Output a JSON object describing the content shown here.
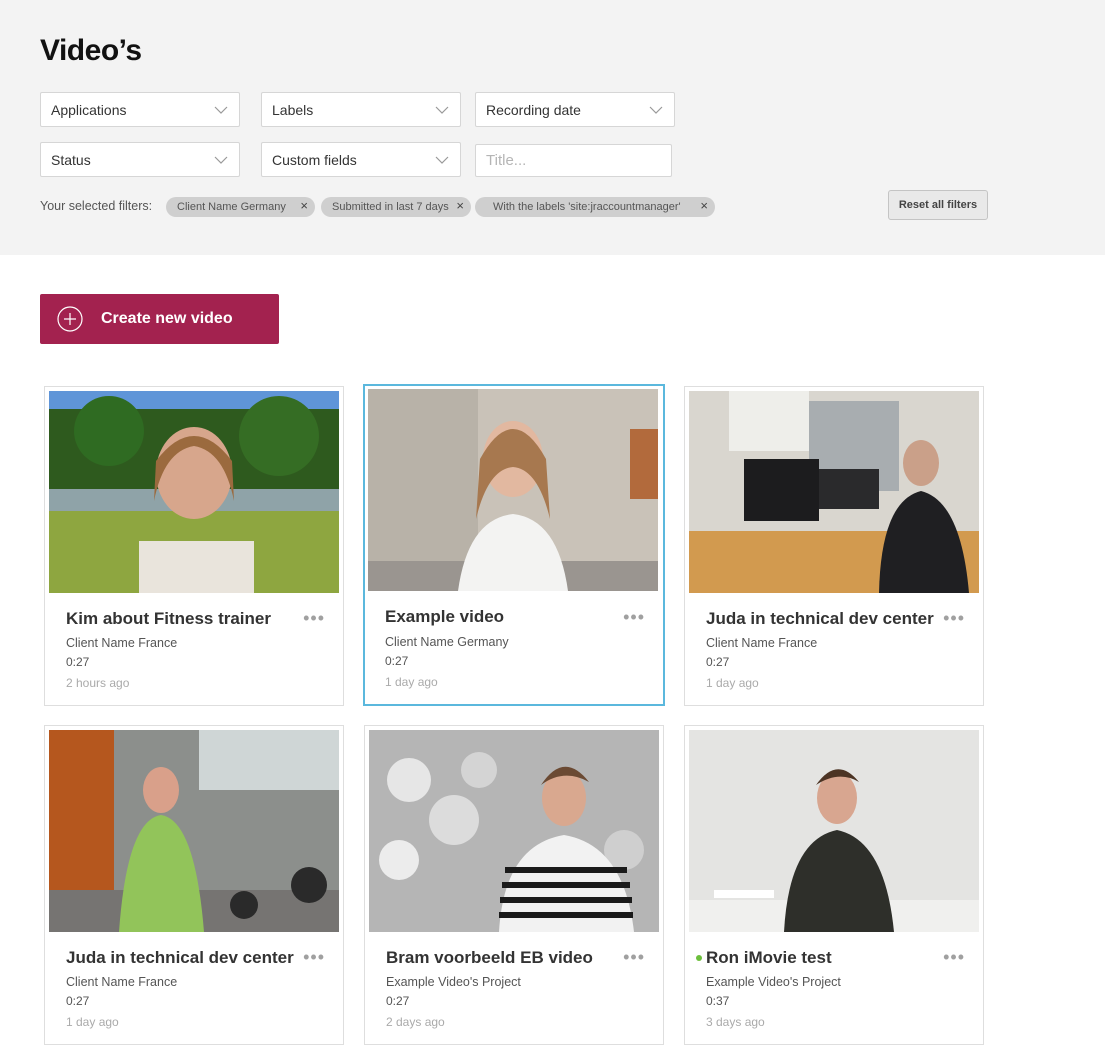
{
  "page": {
    "title": "Video’s"
  },
  "filters": {
    "dropdowns": [
      {
        "label": "Applications"
      },
      {
        "label": "Labels"
      },
      {
        "label": "Recording date"
      },
      {
        "label": "Status"
      },
      {
        "label": "Custom fields"
      }
    ],
    "title_placeholder": "Title...",
    "selected_label": "Your selected filters:",
    "chips": [
      "Client Name Germany",
      "Submitted in last 7 days",
      "With the labels 'site:jraccountmanager'"
    ],
    "reset_label": "Reset all filters"
  },
  "create_button": {
    "label": "Create new video"
  },
  "videos": [
    {
      "title": "Kim about Fitness trainer",
      "client": "Client Name France",
      "duration": "0:27",
      "time": "2 hours ago",
      "status": ""
    },
    {
      "title": "Example video",
      "client": "Client Name Germany",
      "duration": "0:27",
      "time": "1 day ago",
      "status": ""
    },
    {
      "title": "Juda in technical dev center",
      "client": "Client Name France",
      "duration": "0:27",
      "time": "1 day ago",
      "status": ""
    },
    {
      "title": "Juda in technical dev center",
      "client": "Client Name France",
      "duration": "0:27",
      "time": "1 day ago",
      "status": ""
    },
    {
      "title": "Bram voorbeeld EB video",
      "client": "Example Video's Project",
      "duration": "0:27",
      "time": "2 days ago",
      "status": ""
    },
    {
      "title": "Ron iMovie test",
      "client": "Example Video's Project",
      "duration": "0:37",
      "time": "3 days ago",
      "status": "active"
    }
  ],
  "colors": {
    "accent": "#a3224f",
    "selected_border": "#5bb8dd",
    "status_dot": "#6cbf3c"
  },
  "icons": {
    "dropdown": "chevron-down-icon",
    "chip_remove": "close-icon",
    "create": "plus-circle-icon",
    "card_menu": "more-icon"
  }
}
